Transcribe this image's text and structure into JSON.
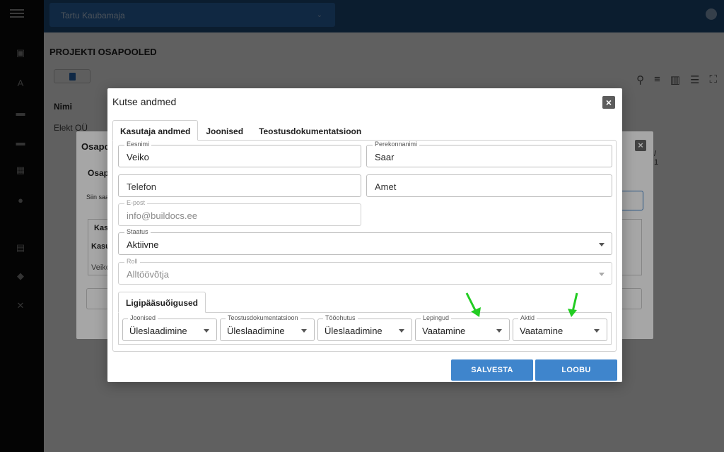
{
  "topbar": {
    "project": "Tartu Kaubamaja"
  },
  "page": {
    "title": "PROJEKTI OSAPOOLED",
    "grid_header": "Nimi",
    "grid_row": "Elekt OÜ"
  },
  "bg_dialog": {
    "title": "Osapo",
    "subtitle": "Osap",
    "text": "Siin saa",
    "col1": "Kasu",
    "col2": "Kasu",
    "row": "Veiko",
    "pager": "/ 1"
  },
  "dialog": {
    "title": "Kutse andmed",
    "tabs": [
      "Kasutaja andmed",
      "Joonised",
      "Teostusdokumentatsioon"
    ],
    "fields": {
      "first_name": {
        "label": "Eesnimi",
        "value": "Veiko"
      },
      "last_name": {
        "label": "Perekonnanimi",
        "value": "Saar"
      },
      "phone": {
        "placeholder": "Telefon"
      },
      "position": {
        "placeholder": "Amet"
      },
      "email": {
        "label": "E-post",
        "value": "info@buildocs.ee"
      },
      "status": {
        "label": "Staatus",
        "value": "Aktiivne"
      },
      "role": {
        "label": "Roll",
        "value": "Alltöövõtja"
      }
    },
    "access": {
      "tab_label": "Ligipääsuõigused",
      "items": [
        {
          "label": "Joonised",
          "value": "Üleslaadimine"
        },
        {
          "label": "Teostusdokumentatsioon",
          "value": "Üleslaadimine"
        },
        {
          "label": "Tööohutus",
          "value": "Üleslaadimine"
        },
        {
          "label": "Lepingud",
          "value": "Vaatamine"
        },
        {
          "label": "Aktid",
          "value": "Vaatamine"
        }
      ]
    },
    "buttons": {
      "save": "SALVESTA",
      "cancel": "LOOBU"
    }
  },
  "colors": {
    "primary": "#3f85cc",
    "topbar": "#1f4e7f",
    "annotation_arrow": "#22cc22"
  }
}
